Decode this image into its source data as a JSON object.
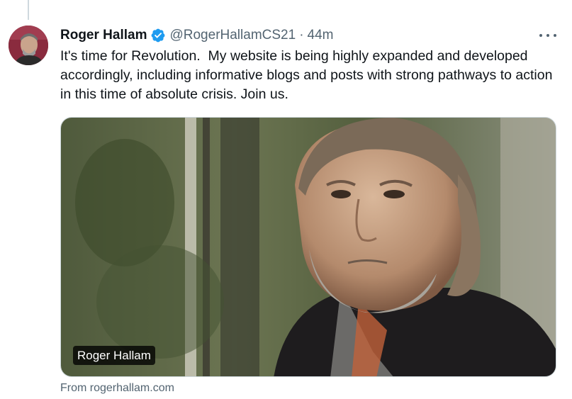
{
  "tweet": {
    "author_name": "Roger Hallam",
    "handle": "@RogerHallamCS21",
    "separator": "·",
    "time": "44m",
    "text": "It's time for Revolution.  My website is being highly expanded and developed accordingly, including informative blogs and posts with strong pathways to action in this time of absolute crisis. Join us.",
    "verified": true,
    "media": {
      "card_label": "Roger Hallam"
    },
    "source": "From rogerhallam.com"
  },
  "colors": {
    "text_primary": "#0f1419",
    "text_secondary": "#536471",
    "verified_blue": "#1d9bf0",
    "border": "#cfd9de"
  },
  "icons": [
    "verified-badge-icon",
    "more-options-icon"
  ]
}
